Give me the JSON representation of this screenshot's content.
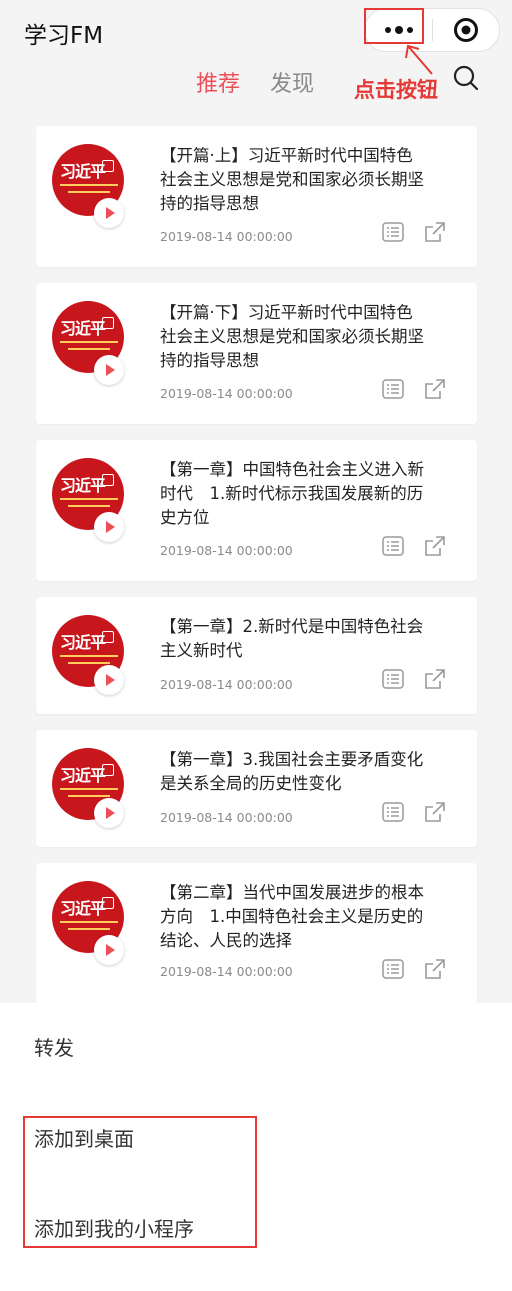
{
  "app": {
    "title": "学习FM"
  },
  "annotation": {
    "text": "点击按钮"
  },
  "tabs": [
    {
      "label": "推荐"
    },
    {
      "label": "发现"
    }
  ],
  "colors": {
    "accent": "#ec4f58",
    "annotation": "#e53935",
    "cover": "#c8161d"
  },
  "cover": {
    "logo_text": "习近平"
  },
  "cards": [
    {
      "lines": [
        "【开篇·上】习近平新时代中国特色",
        "社会主义思想是党和国家必须长期坚",
        "持的指导思想"
      ],
      "date": "2019-08-14 00:00:00"
    },
    {
      "lines": [
        "【开篇·下】习近平新时代中国特色",
        "社会主义思想是党和国家必须长期坚",
        "持的指导思想"
      ],
      "date": "2019-08-14 00:00:00"
    },
    {
      "lines": [
        "【第一章】中国特色社会主义进入新",
        "时代　1.新时代标示我国发展新的历",
        "史方位"
      ],
      "date": "2019-08-14 00:00:00"
    },
    {
      "lines": [
        "【第一章】2.新时代是中国特色社会",
        "主义新时代"
      ],
      "date": "2019-08-14 00:00:00"
    },
    {
      "lines": [
        "【第一章】3.我国社会主要矛盾变化",
        "是关系全局的历史性变化"
      ],
      "date": "2019-08-14 00:00:00"
    },
    {
      "lines": [
        "【第二章】当代中国发展进步的根本",
        "方向　1.中国特色社会主义是历史的",
        "结论、人民的选择"
      ],
      "date": "2019-08-14 00:00:00"
    }
  ],
  "sheet": {
    "items": [
      {
        "label": "转发"
      },
      {
        "label": "添加到桌面"
      },
      {
        "label": "添加到我的小程序"
      }
    ]
  }
}
